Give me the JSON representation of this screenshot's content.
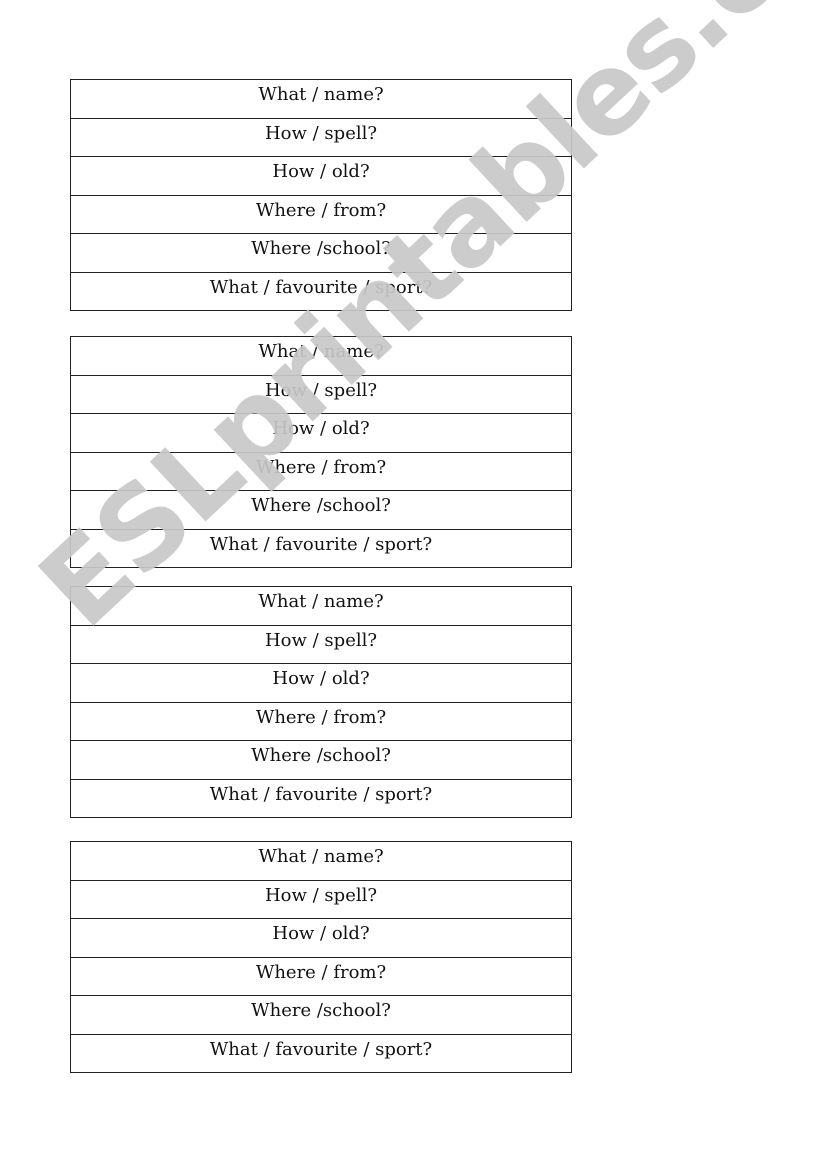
{
  "worksheet": {
    "cards": [
      {
        "questions": [
          "What / name?",
          "How / spell?",
          "How / old?",
          "Where / from?",
          "Where /school?",
          "What / favourite / sport?"
        ]
      },
      {
        "questions": [
          "What / name?",
          "How / spell?",
          "How / old?",
          "Where / from?",
          "Where /school?",
          "What / favourite / sport?"
        ]
      },
      {
        "questions": [
          "What / name?",
          "How / spell?",
          "How / old?",
          "Where / from?",
          "Where /school?",
          "What / favourite / sport?"
        ]
      },
      {
        "questions": [
          "What / name?",
          "How / spell?",
          "How / old?",
          "Where / from?",
          "Where /school?",
          "What / favourite / sport?"
        ]
      }
    ]
  },
  "watermark": {
    "text": "ESLprintables.com",
    "color": "#c8c8c8"
  }
}
